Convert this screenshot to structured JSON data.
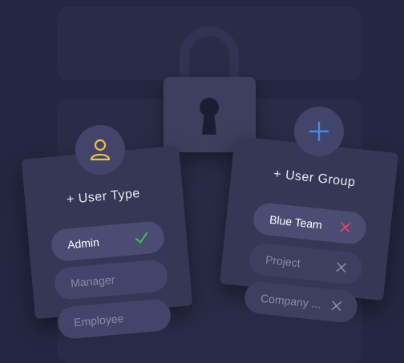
{
  "user_type_card": {
    "title": "+ User Type",
    "options": [
      {
        "label": "Admin",
        "state": "selected"
      },
      {
        "label": "Manager",
        "state": "unselected"
      },
      {
        "label": "Employee",
        "state": "unselected"
      }
    ]
  },
  "user_group_card": {
    "title": "+ User Group",
    "groups": [
      {
        "label": "Blue Team",
        "state": "selected"
      },
      {
        "label": "Project",
        "state": "unselected"
      },
      {
        "label": "Company ...",
        "state": "unselected"
      }
    ]
  },
  "icons": {
    "lock": "lock-icon",
    "user": "user-icon",
    "plus": "plus-icon",
    "check": "check-icon",
    "remove": "x-icon"
  },
  "colors": {
    "background": "#252641",
    "card": "#363755",
    "accent_yellow": "#f0c040",
    "accent_blue": "#3b8ef0",
    "check_green": "#3fbf5a",
    "remove_red": "#e0455a",
    "remove_gray": "#8a8ba8"
  }
}
